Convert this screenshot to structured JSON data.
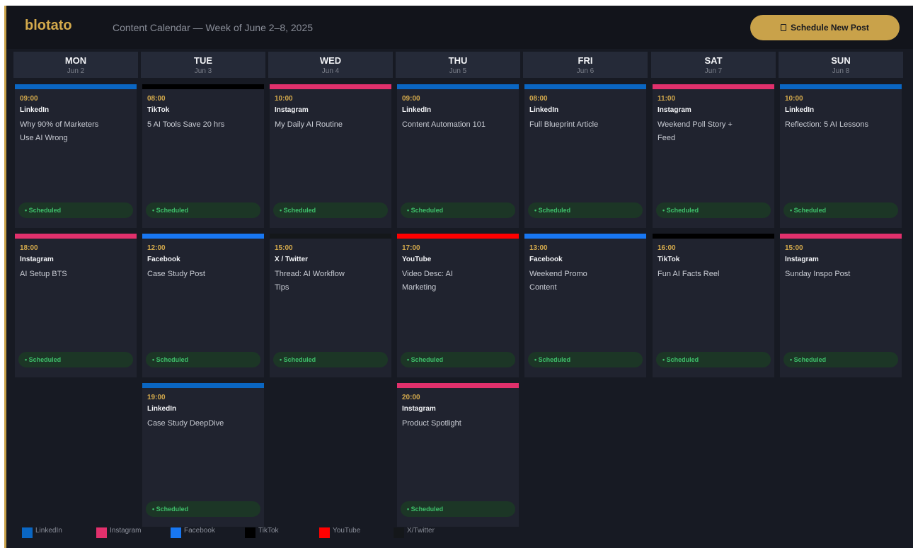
{
  "header": {
    "logo": "blotato",
    "subtitle": "Content Calendar  —  Week of June 2–8, 2025",
    "schedule_button": "Schedule New Post"
  },
  "colors": {
    "accent": "#c9a24a",
    "LinkedIn": "#0a66c2",
    "Instagram": "#e1306c",
    "Facebook": "#1877f2",
    "TikTok": "#000000",
    "YouTube": "#ff0000",
    "X / Twitter": "#14171a"
  },
  "days": [
    {
      "name": "MON",
      "date": "Jun 2"
    },
    {
      "name": "TUE",
      "date": "Jun 3"
    },
    {
      "name": "WED",
      "date": "Jun 4"
    },
    {
      "name": "THU",
      "date": "Jun 5"
    },
    {
      "name": "FRI",
      "date": "Jun 6"
    },
    {
      "name": "SAT",
      "date": "Jun 7"
    },
    {
      "name": "SUN",
      "date": "Jun 8"
    }
  ],
  "posts": [
    {
      "day": 0,
      "slot": 0,
      "time": "09:00",
      "platform": "LinkedIn",
      "title": "Why 90% of Marketers Use AI Wrong",
      "status": "• Scheduled"
    },
    {
      "day": 1,
      "slot": 0,
      "time": "08:00",
      "platform": "TikTok",
      "title": "5 AI Tools Save 20 hrs",
      "status": "• Scheduled"
    },
    {
      "day": 2,
      "slot": 0,
      "time": "10:00",
      "platform": "Instagram",
      "title": "My Daily AI Routine",
      "status": "• Scheduled"
    },
    {
      "day": 3,
      "slot": 0,
      "time": "09:00",
      "platform": "LinkedIn",
      "title": "Content Automation 101",
      "status": "• Scheduled"
    },
    {
      "day": 4,
      "slot": 0,
      "time": "08:00",
      "platform": "LinkedIn",
      "title": "Full Blueprint Article",
      "status": "• Scheduled"
    },
    {
      "day": 5,
      "slot": 0,
      "time": "11:00",
      "platform": "Instagram",
      "title": "Weekend Poll Story + Feed",
      "status": "• Scheduled"
    },
    {
      "day": 6,
      "slot": 0,
      "time": "10:00",
      "platform": "LinkedIn",
      "title": "Reflection: 5 AI Lessons",
      "status": "• Scheduled"
    },
    {
      "day": 0,
      "slot": 1,
      "time": "18:00",
      "platform": "Instagram",
      "title": "AI Setup BTS",
      "status": "• Scheduled"
    },
    {
      "day": 1,
      "slot": 1,
      "time": "12:00",
      "platform": "Facebook",
      "title": "Case Study Post",
      "status": "• Scheduled"
    },
    {
      "day": 2,
      "slot": 1,
      "time": "15:00",
      "platform": "X / Twitter",
      "title": "Thread: AI Workflow Tips",
      "status": "• Scheduled"
    },
    {
      "day": 3,
      "slot": 1,
      "time": "17:00",
      "platform": "YouTube",
      "title": "Video Desc: AI Marketing",
      "status": "• Scheduled"
    },
    {
      "day": 4,
      "slot": 1,
      "time": "13:00",
      "platform": "Facebook",
      "title": "Weekend Promo Content",
      "status": "• Scheduled"
    },
    {
      "day": 5,
      "slot": 1,
      "time": "16:00",
      "platform": "TikTok",
      "title": "Fun AI Facts Reel",
      "status": "• Scheduled"
    },
    {
      "day": 6,
      "slot": 1,
      "time": "15:00",
      "platform": "Instagram",
      "title": "Sunday Inspo Post",
      "status": "• Scheduled"
    },
    {
      "day": 1,
      "slot": 2,
      "time": "19:00",
      "platform": "LinkedIn",
      "title": "Case Study DeepDive",
      "status": "• Scheduled"
    },
    {
      "day": 3,
      "slot": 2,
      "time": "20:00",
      "platform": "Instagram",
      "title": "Product Spotlight",
      "status": "• Scheduled"
    }
  ],
  "legend": [
    {
      "label": "LinkedIn",
      "color": "#0a66c2"
    },
    {
      "label": "Instagram",
      "color": "#e1306c"
    },
    {
      "label": "Facebook",
      "color": "#1877f2"
    },
    {
      "label": "TikTok",
      "color": "#000000"
    },
    {
      "label": "YouTube",
      "color": "#ff0000"
    },
    {
      "label": "X/Twitter",
      "color": "#14171a"
    }
  ]
}
